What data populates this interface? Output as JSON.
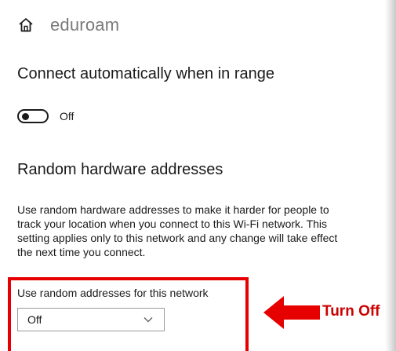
{
  "header": {
    "network_name": "eduroam",
    "home_icon": "home-icon"
  },
  "auto_connect": {
    "title": "Connect automatically when in range",
    "toggle_state": "Off"
  },
  "random_hw": {
    "title": "Random hardware addresses",
    "description_lines": [
      "Use random hardware addresses to make it harder for people to",
      "track your location when you connect to this Wi-Fi network. This",
      "setting applies only to this network and any change will take effect",
      "the next time you connect."
    ],
    "dropdown_label": "Use random addresses for this network",
    "dropdown_value": "Off",
    "dropdown_icon": "chevron-down-icon"
  },
  "annotation": {
    "text": "Turn Off",
    "color": "#cc0000",
    "box_color": "#e60000",
    "arrow_color": "#e60000"
  }
}
